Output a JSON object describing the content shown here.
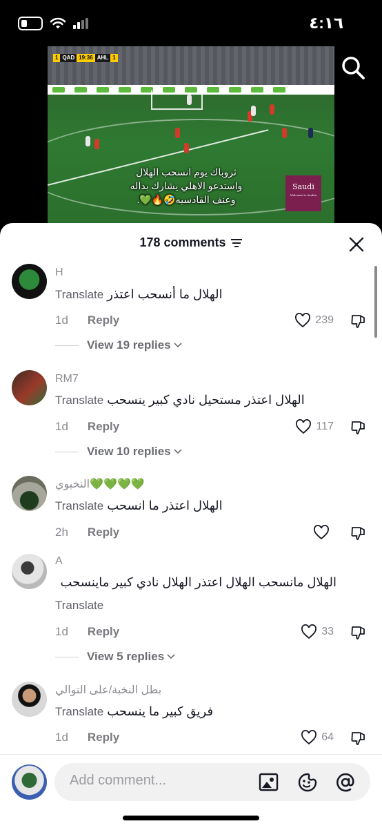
{
  "status_bar": {
    "time": "٤:١٦"
  },
  "video": {
    "scorebug": {
      "team_home": "QAD",
      "time": "19:36",
      "team_away": "AHL",
      "score_home": "1",
      "score_away": "1"
    },
    "caption_lines": [
      "ثروباك يوم انسحب الهلال",
      "واستدعو الاهلي يشارك بداله",
      "وعنف القادسيه🤣🔥💚."
    ],
    "sponsor_text": "Saudi",
    "sponsor_subtext": "Welcome to Arabia"
  },
  "comments_header": {
    "count_label": "178 comments"
  },
  "comments": [
    {
      "username": "H",
      "text": "الهلال ما أنسحب اعتذر",
      "translate": "Translate",
      "time": "1d",
      "reply": "Reply",
      "likes": "239",
      "view_replies": "View 19 replies"
    },
    {
      "username": "RM7",
      "text": "الهلال اعتذر مستحيل نادي كبير ينسحب",
      "translate": "Translate",
      "time": "1d",
      "reply": "Reply",
      "likes": "117",
      "view_replies": "View 10 replies"
    },
    {
      "username": "💚💚💚💚النخبوي",
      "text": "الهلال اعتذر ما انسحب",
      "translate": "Translate",
      "time": "2h",
      "reply": "Reply",
      "likes": ""
    },
    {
      "username": "A",
      "text": "الهلال مانسحب الهلال اعتذر الهلال نادي كبير ماينسحب",
      "translate": "Translate",
      "time": "1d",
      "reply": "Reply",
      "likes": "33",
      "view_replies": "View 5 replies"
    },
    {
      "username": "بطل النخبة/على التوالي",
      "text": "فريق كبير ما ينسحب",
      "translate": "Translate",
      "time": "1d",
      "reply": "Reply",
      "likes": "64"
    }
  ],
  "composer": {
    "placeholder": "Add comment..."
  },
  "icons": [
    "battery-icon",
    "wifi-icon",
    "signal-icon",
    "search-icon",
    "filter-icon",
    "close-icon",
    "heart-icon",
    "dislike-icon",
    "chevron-down-icon",
    "image-icon",
    "emoji-icon",
    "at-icon"
  ]
}
